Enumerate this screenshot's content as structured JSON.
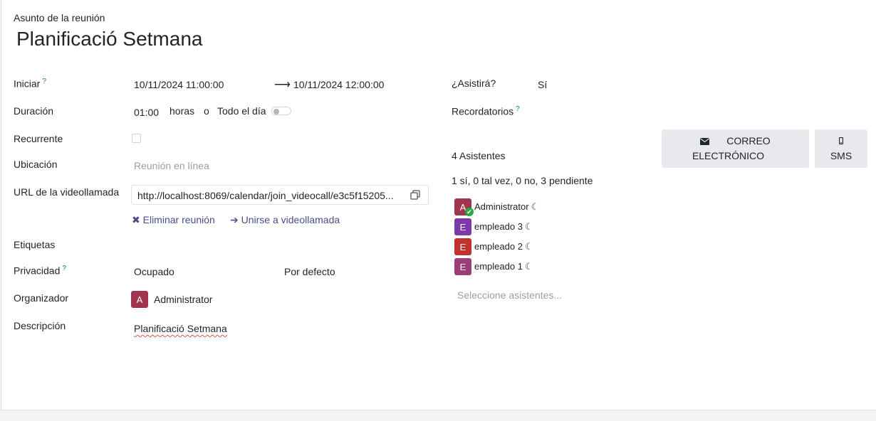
{
  "header": {
    "subject_label": "Asunto de la reunión",
    "title": "Planificació Setmana"
  },
  "fields": {
    "start_label": "Iniciar",
    "start_help": "?",
    "start_value": "10/11/2024 11:00:00",
    "end_value": "10/11/2024 12:00:00",
    "duration_label": "Duración",
    "duration_value": "01:00",
    "duration_unit": "horas",
    "duration_or": "o",
    "allday_label": "Todo el día",
    "recurrent_label": "Recurrente",
    "location_label": "Ubicación",
    "location_placeholder": "Reunión en línea",
    "videocall_label": "URL de la videollamada",
    "videocall_url": "http://localhost:8069/calendar/join_videocall/e3c5f15205...",
    "delete_meeting": "Eliminar reunión",
    "join_videocall": "Unirse a videollamada",
    "tags_label": "Etiquetas",
    "privacy_label": "Privacidad",
    "privacy_help": "?",
    "privacy_value": "Ocupado",
    "privacy_default": "Por defecto",
    "organizer_label": "Organizador",
    "organizer_initial": "A",
    "organizer_name": "Administrator",
    "description_label": "Descripción",
    "description_value": "Planificació Setmana"
  },
  "right": {
    "attend_label": "¿Asistirá?",
    "attend_value": "Sí",
    "reminders_label": "Recordatorios",
    "reminders_help": "?",
    "email_button": "CORREO ELECTRÓNICO",
    "sms_button": "SMS",
    "attendees_count": "4 Asistentes",
    "attendees_summary": "1 sí, 0 tal vez, 0 no, 3 pendiente",
    "attendees": [
      {
        "initial": "A",
        "name": "Administrator",
        "color": "#a2344d"
      },
      {
        "initial": "E",
        "name": "empleado 3",
        "color": "#7c3aa8"
      },
      {
        "initial": "E",
        "name": "empleado 2",
        "color": "#c0322b"
      },
      {
        "initial": "E",
        "name": "empleado 1",
        "color": "#9c3d75"
      }
    ],
    "attendee_placeholder": "Seleccione asistentes..."
  },
  "colors": {
    "accent": "#017e84",
    "link": "#4a4f88",
    "organizer_avatar": "#a2344d"
  },
  "icons": {
    "arrow": "long-arrow-right-icon",
    "copy": "copy-icon",
    "delete": "times-icon",
    "join": "arrow-right-icon",
    "email": "envelope-icon",
    "sms": "mobile-icon",
    "moon": "moon-icon",
    "check": "check-icon"
  }
}
